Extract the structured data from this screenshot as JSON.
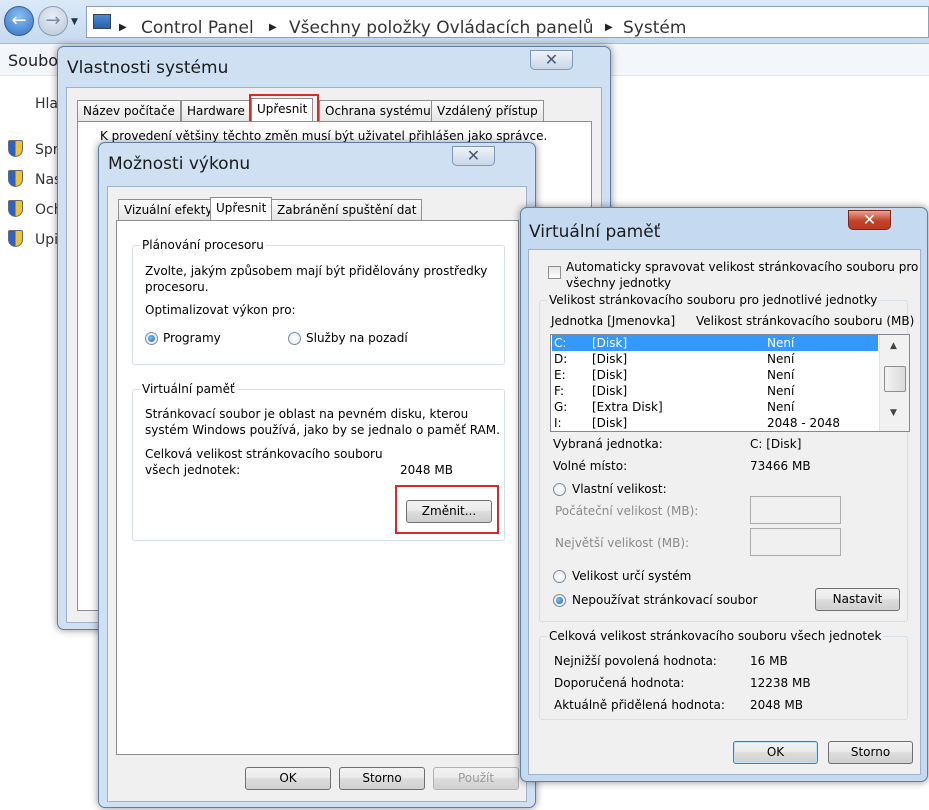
{
  "explorer": {
    "breadcrumbs": [
      "Control Panel",
      "Všechny položky Ovládacích panelů",
      "Systém"
    ],
    "menu_fragment": "Soubo",
    "left_items": [
      "Hla",
      "Spr",
      "Nas",
      "Och",
      "Upi"
    ]
  },
  "system_properties": {
    "title": "Vlastnosti systému",
    "tabs": [
      "Název počítače",
      "Hardware",
      "Upřesnit",
      "Ochrana systému",
      "Vzdálený přístup"
    ],
    "active_tab": "Upřesnit",
    "notice": "K provedení většiny těchto změn musí být uživatel přihlášen jako správce."
  },
  "performance_options": {
    "title": "Možnosti výkonu",
    "tabs": [
      "Vizuální efekty",
      "Upřesnit",
      "Zabránění spuštění dat"
    ],
    "active_tab": "Upřesnit",
    "cpu_group": {
      "label": "Plánování procesoru",
      "description_line1": "Zvolte, jakým způsobem mají být přidělovány prostředky",
      "description_line2": "procesoru.",
      "optimize_label": "Optimalizovat výkon pro:",
      "option_programs": "Programy",
      "option_services": "Služby na pozadí",
      "selected": "Programy"
    },
    "vm_group": {
      "label": "Virtuální paměť",
      "description_line1": "Stránkovací soubor je oblast na pevném disku, kterou",
      "description_line2": "systém Windows používá, jako by se jednalo o paměť RAM.",
      "total_label_line1": "Celková velikost stránkovacího souboru",
      "total_label_line2": "všech jednotek:",
      "total_value": "2048 MB",
      "change_button": "Změnit..."
    },
    "buttons": {
      "ok": "OK",
      "cancel": "Storno",
      "apply": "Použít"
    }
  },
  "virtual_memory": {
    "title": "Virtuální paměť",
    "auto_manage_line1": "Automaticky spravovat velikost stránkovacího souboru pro",
    "auto_manage_line2": "všechny jednotky",
    "auto_manage_checked": false,
    "per_drive_group_label": "Velikost stránkovacího souboru pro jednotlivé jednotky",
    "col_drive": "Jednotka [Jmenovka]",
    "col_size": "Velikost stránkovacího souboru (MB)",
    "drives": [
      {
        "letter": "C:",
        "label": "[Disk]",
        "size": "Není",
        "selected": true
      },
      {
        "letter": "D:",
        "label": "[Disk]",
        "size": "Není",
        "selected": false
      },
      {
        "letter": "E:",
        "label": "[Disk]",
        "size": "Není",
        "selected": false
      },
      {
        "letter": "F:",
        "label": "[Disk]",
        "size": "Není",
        "selected": false
      },
      {
        "letter": "G:",
        "label": "[Extra Disk]",
        "size": "Není",
        "selected": false
      },
      {
        "letter": "I:",
        "label": "[Disk]",
        "size": "2048 - 2048",
        "selected": false
      }
    ],
    "selected_drive_label": "Vybraná jednotka:",
    "selected_drive_value": "C:  [Disk]",
    "free_space_label": "Volné místo:",
    "free_space_value": "73466 MB",
    "custom_size": "Vlastní velikost:",
    "initial_size": "Počáteční velikost (MB):",
    "max_size": "Největší velikost (MB):",
    "initial_value": "",
    "max_value": "",
    "system_managed": "Velikost určí systém",
    "no_paging": "Nepoužívat stránkovací soubor",
    "selected_option": "Nepoužívat stránkovací soubor",
    "set_button": "Nastavit",
    "totals_group_label": "Celková velikost stránkovacího souboru všech jednotek",
    "min_label": "Nejnižší povolená hodnota:",
    "min_value": "16 MB",
    "recommended_label": "Doporučená hodnota:",
    "recommended_value": "12238 MB",
    "allocated_label": "Aktuálně přidělená hodnota:",
    "allocated_value": "2048 MB",
    "ok": "OK",
    "cancel": "Storno"
  }
}
